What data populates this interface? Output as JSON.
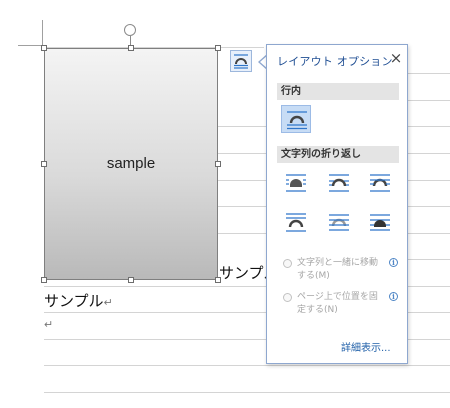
{
  "image": {
    "label": "sample"
  },
  "document": {
    "line1_text": "サンプル",
    "line2_text": "サンプル",
    "paragraph_mark": "↵"
  },
  "layout_popup": {
    "title": "レイアウト オプション",
    "close_glyph": "×",
    "section_inline": "行内",
    "section_wrap": "文字列の折り返し",
    "radio_move_with_text": "文字列と一緒に移動する(M)",
    "radio_fix_position": "ページ上で位置を固定する(N)",
    "info_glyph": "i",
    "more_link": "詳細表示..."
  },
  "colors": {
    "accent": "#1f4e93",
    "link": "#1f5fa8",
    "selected_option": "#c7dcf5",
    "icon_blue": "#2e75c9"
  }
}
